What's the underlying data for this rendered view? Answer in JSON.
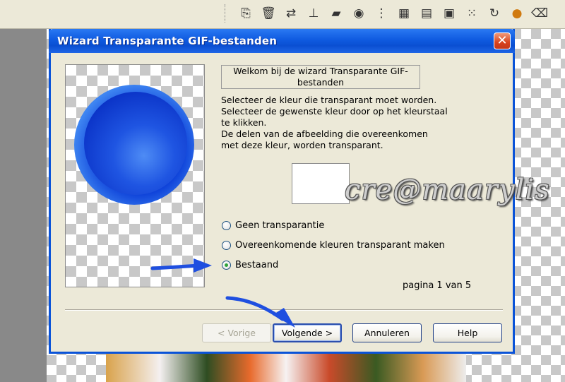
{
  "dialog": {
    "title": "Wizard Transparante GIF-bestanden",
    "close_label": "✕",
    "welcome": "Welkom bij de wizard Transparante GIF-bestanden",
    "instructions": "Selecteer de kleur die transparant moet worden.\nSelecteer de gewenste kleur door op het kleurstaal\nte klikken.\nDe delen van de afbeelding die overeenkomen\nmet deze kleur, worden transparant.",
    "swatch_color": "#ffffff",
    "options": [
      {
        "label": "Geen transparantie",
        "checked": false
      },
      {
        "label": "Overeenkomende kleuren transparant maken",
        "checked": false
      },
      {
        "label": "Bestaand",
        "checked": true
      }
    ],
    "page_indicator": "pagina 1 van 5",
    "buttons": {
      "back": "< Vorige",
      "next": "Volgende >",
      "cancel": "Annuleren",
      "help": "Help"
    }
  },
  "watermark": "cre@maarylis",
  "toolbar_icons": [
    "copy-icon",
    "trash-icon",
    "move-icon",
    "stamp-icon",
    "folder-open-icon",
    "binoculars-icon",
    "tree-icon",
    "grid-icon",
    "printer-icon",
    "crop-icon",
    "grid-small-icon",
    "refresh-icon",
    "color-icon",
    "clear-icon"
  ],
  "colors": {
    "title_bar": "#0a53d8",
    "dialog_bg": "#ece9d8",
    "arrow": "#1f4fe0",
    "radio_checked": "#2ea33a"
  }
}
